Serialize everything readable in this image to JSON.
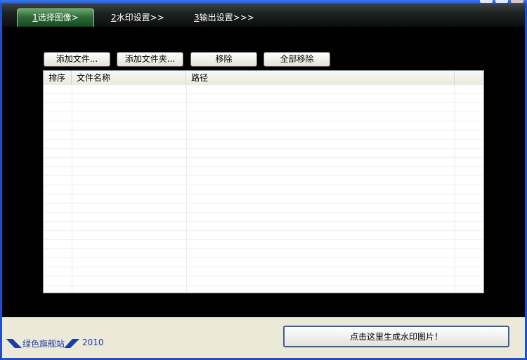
{
  "tabs": [
    {
      "key": "1",
      "label": "选择图像>"
    },
    {
      "key": "2",
      "label": "水印设置>>"
    },
    {
      "key": "3",
      "label": "输出设置>>>"
    }
  ],
  "toolbar": {
    "add_file": "添加文件...",
    "add_folder": "添加文件夹...",
    "remove": "移除",
    "remove_all": "全部移除"
  },
  "table": {
    "columns": [
      "排序",
      "文件名称",
      "路径"
    ],
    "rows": []
  },
  "footer": {
    "site": "绿色旗舰站",
    "year": "2010",
    "generate_label": "点击这里生成水印图片！"
  },
  "colors": {
    "active_tab": "#2e6a35",
    "content_bg": "#000000",
    "footer_link": "#1a3ea8"
  }
}
